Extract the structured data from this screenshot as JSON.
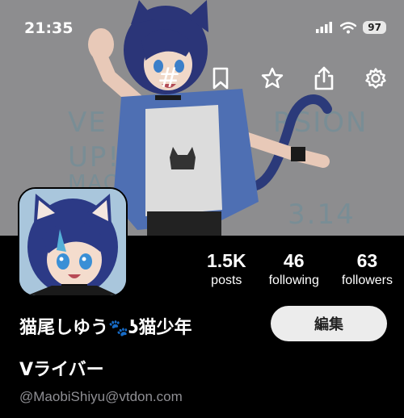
{
  "status_bar": {
    "time": "21:35",
    "battery": "97",
    "icons": [
      "cellular-signal-icon",
      "wifi-icon",
      "battery-icon"
    ]
  },
  "header": {
    "art_text": [
      "VE",
      "RSION",
      "UP!",
      "MAOBI",
      "3.14"
    ],
    "toolbar": {
      "hashtag": "#",
      "icons": [
        "hashtag-icon",
        "bookmark-icon",
        "star-icon",
        "share-icon",
        "gear-icon"
      ]
    }
  },
  "profile": {
    "display_name_part1": "猫尾しゆう",
    "display_name_emoji": "🐾",
    "display_name_part2": "ʖ猫少年",
    "display_name_line2": "Vライバー",
    "handle": "@MaobiShiyu@vtdon.com",
    "edit_label": "編集",
    "stats": [
      {
        "value": "1.5K",
        "label": "posts"
      },
      {
        "value": "46",
        "label": "following"
      },
      {
        "value": "63",
        "label": "followers"
      }
    ]
  },
  "colors": {
    "header_bg": "#8d8d8f",
    "page_bg": "#000000",
    "edit_button_bg": "#ececec",
    "handle_text": "#8f8f94"
  }
}
